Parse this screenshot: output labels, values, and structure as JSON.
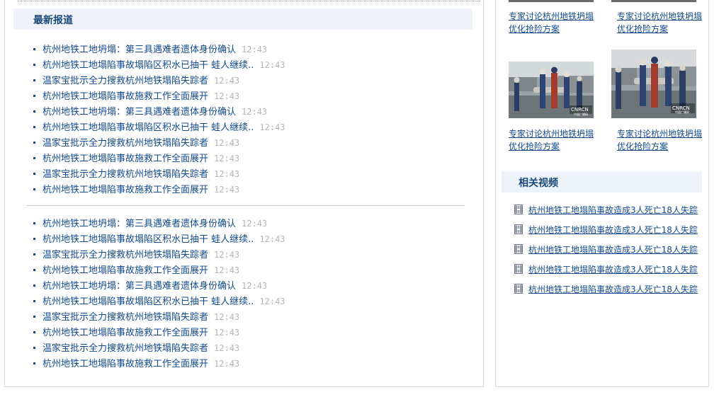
{
  "main": {
    "section_title": "最新报道",
    "list_1": [
      {
        "title": "杭州地铁工地坍塌：第三具遇难者遗体身份确认",
        "time": "12:43"
      },
      {
        "title": "杭州地铁工地塌陷事故塌陷区积水已抽干 蛙人继续..",
        "time": "12:43"
      },
      {
        "title": "温家宝批示全力搜救杭州地铁塌陷失踪者",
        "time": "12:43"
      },
      {
        "title": "杭州地铁工地塌陷事故施救工作全面展开",
        "time": "12:43"
      },
      {
        "title": "杭州地铁工地坍塌：第三具遇难者遗体身份确认",
        "time": "12:43"
      },
      {
        "title": "杭州地铁工地塌陷事故塌陷区积水已抽干 蛙人继续..",
        "time": "12:43"
      },
      {
        "title": "温家宝批示全力搜救杭州地铁塌陷失踪者",
        "time": "12:43"
      },
      {
        "title": "杭州地铁工地塌陷事故施救工作全面展开",
        "time": "12:43"
      },
      {
        "title": "温家宝批示全力搜救杭州地铁塌陷失踪者",
        "time": "12:43"
      },
      {
        "title": "杭州地铁工地塌陷事故施救工作全面展开",
        "time": "12:43"
      }
    ],
    "list_2": [
      {
        "title": "杭州地铁工地坍塌：第三具遇难者遗体身份确认",
        "time": "12:43"
      },
      {
        "title": "杭州地铁工地塌陷事故塌陷区积水已抽干 蛙人继续..",
        "time": "12:43"
      },
      {
        "title": "温家宝批示全力搜救杭州地铁塌陷失踪者",
        "time": "12:43"
      },
      {
        "title": "杭州地铁工地塌陷事故施救工作全面展开",
        "time": "12:43"
      },
      {
        "title": "杭州地铁工地坍塌：第三具遇难者遗体身份确认",
        "time": "12:43"
      },
      {
        "title": "杭州地铁工地塌陷事故塌陷区积水已抽干 蛙人继续..",
        "time": "12:43"
      },
      {
        "title": "温家宝批示全力搜救杭州地铁塌陷失踪者",
        "time": "12:43"
      },
      {
        "title": "杭州地铁工地塌陷事故施救工作全面展开",
        "time": "12:43"
      },
      {
        "title": "温家宝批示全力搜救杭州地铁塌陷失踪者",
        "time": "12:43"
      },
      {
        "title": "杭州地铁工地塌陷事故施救工作全面展开",
        "time": "12:43"
      }
    ]
  },
  "sidebar": {
    "photos": [
      {
        "caption_line1": "专家讨论杭州地铁坍塌",
        "caption_line2": "优化抢险方案"
      },
      {
        "caption_line1": "专家讨论杭州地铁坍塌",
        "caption_line2": "优化抢险方案"
      },
      {
        "caption_line1": "专家讨论杭州地铁坍塌",
        "caption_line2": "优化抢险方案"
      },
      {
        "caption_line1": "专家讨论杭州地铁坍塌",
        "caption_line2": "优化抢险方案"
      }
    ],
    "photo_watermark": "CNRCN",
    "photo_watermark_sub": "中国广播网",
    "video_section_title": "相关视频",
    "videos": [
      {
        "title": "杭州地铁工地塌陷事故造成3人死亡18人失踪"
      },
      {
        "title": "杭州地铁工地塌陷事故造成3人死亡18人失踪"
      },
      {
        "title": "杭州地铁工地塌陷事故造成3人死亡18人失踪"
      },
      {
        "title": "杭州地铁工地塌陷事故造成3人死亡18人失踪"
      },
      {
        "title": "杭州地铁工地塌陷事故造成3人死亡18人失踪"
      }
    ]
  },
  "colors": {
    "link": "#124a8c",
    "time": "#b5b5b5",
    "title_bg": "#f0f4fa"
  }
}
